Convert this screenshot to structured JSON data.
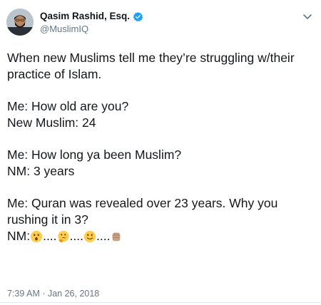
{
  "author": {
    "display_name": "Qasim Rashid, Esq.",
    "handle": "@MuslimIQ",
    "verified": true
  },
  "tweet": {
    "paragraphs": [
      [
        "When new Muslims tell me they’re struggling w/their",
        "practice of Islam."
      ],
      [
        "Me: How old are you?",
        "New Muslim: 24"
      ],
      [
        "Me: How long ya been Muslim?",
        "NM: 3 years"
      ],
      [
        "Me: Quran was revealed over 23 years. Why you",
        "rushing it in 3?"
      ]
    ],
    "final_line": {
      "prefix": "NM:",
      "dots": "....",
      "emojis": [
        "astonished-face-icon",
        "thinking-face-icon",
        "slightly-smiling-face-icon",
        "raised-fist-icon"
      ]
    },
    "timestamp": "7:39 AM · Jan 26, 2018"
  },
  "colors": {
    "text": "#14171a",
    "secondary": "#657786",
    "verified_badge": "#1da1f2",
    "divider": "#e1e8ed"
  }
}
